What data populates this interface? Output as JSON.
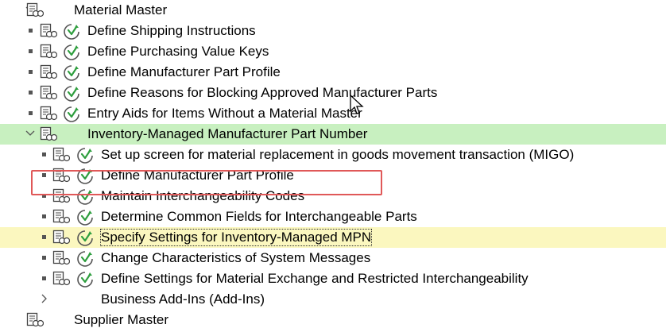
{
  "tree": {
    "rows": [
      {
        "label": "Material Master",
        "level": 0,
        "expander": "chevron-down",
        "exec": false,
        "highlight": "",
        "focus": false
      },
      {
        "label": "Define Shipping Instructions",
        "level": 1,
        "expander": "bullet",
        "exec": true,
        "highlight": "",
        "focus": false
      },
      {
        "label": "Define Purchasing Value Keys",
        "level": 1,
        "expander": "bullet",
        "exec": true,
        "highlight": "",
        "focus": false
      },
      {
        "label": "Define Manufacturer Part Profile",
        "level": 1,
        "expander": "bullet",
        "exec": true,
        "highlight": "",
        "focus": false
      },
      {
        "label": "Define Reasons for Blocking Approved Manufacturer Parts",
        "level": 1,
        "expander": "bullet",
        "exec": true,
        "highlight": "",
        "focus": false
      },
      {
        "label": "Entry Aids for Items Without a Material Master",
        "level": 1,
        "expander": "bullet",
        "exec": true,
        "highlight": "",
        "focus": false
      },
      {
        "label": "Inventory-Managed Manufacturer Part Number",
        "level": 1,
        "expander": "chevron-down",
        "exec": false,
        "highlight": "green",
        "focus": false
      },
      {
        "label": "Set up screen for material replacement in goods movement transaction (MIGO)",
        "level": 2,
        "expander": "bullet",
        "exec": true,
        "highlight": "",
        "focus": false
      },
      {
        "label": "Define Manufacturer Part Profile",
        "level": 2,
        "expander": "bullet",
        "exec": true,
        "highlight": "",
        "focus": false
      },
      {
        "label": "Maintain Interchangeability Codes",
        "level": 2,
        "expander": "bullet",
        "exec": true,
        "highlight": "",
        "focus": false
      },
      {
        "label": "Determine Common Fields for Interchangeable Parts",
        "level": 2,
        "expander": "bullet",
        "exec": true,
        "highlight": "",
        "focus": false
      },
      {
        "label": "Specify Settings for Inventory-Managed MPN",
        "level": 2,
        "expander": "bullet",
        "exec": true,
        "highlight": "yellow",
        "focus": true
      },
      {
        "label": "Change Characteristics of System Messages",
        "level": 2,
        "expander": "bullet",
        "exec": true,
        "highlight": "",
        "focus": false
      },
      {
        "label": "Define Settings for Material Exchange and Restricted Interchangeability",
        "level": 2,
        "expander": "bullet",
        "exec": true,
        "highlight": "",
        "focus": false
      },
      {
        "label": "Business Add-Ins (Add-Ins)",
        "level": 2,
        "expander": "chevron-right",
        "exec": false,
        "highlight": "",
        "focus": false,
        "noDoc": true
      },
      {
        "label": "Supplier Master",
        "level": 0,
        "expander": "chevron-right",
        "exec": false,
        "highlight": "",
        "focus": false
      }
    ]
  },
  "colors": {
    "green_highlight": "#c8f0c0",
    "yellow_highlight": "#fbf7bf",
    "red_box": "#e05858",
    "exec_icon_green": "#2e9e3e"
  },
  "icons": {
    "doc": "documentation-icon",
    "exec": "execute-icon",
    "cursor": "mouse-cursor-icon"
  }
}
